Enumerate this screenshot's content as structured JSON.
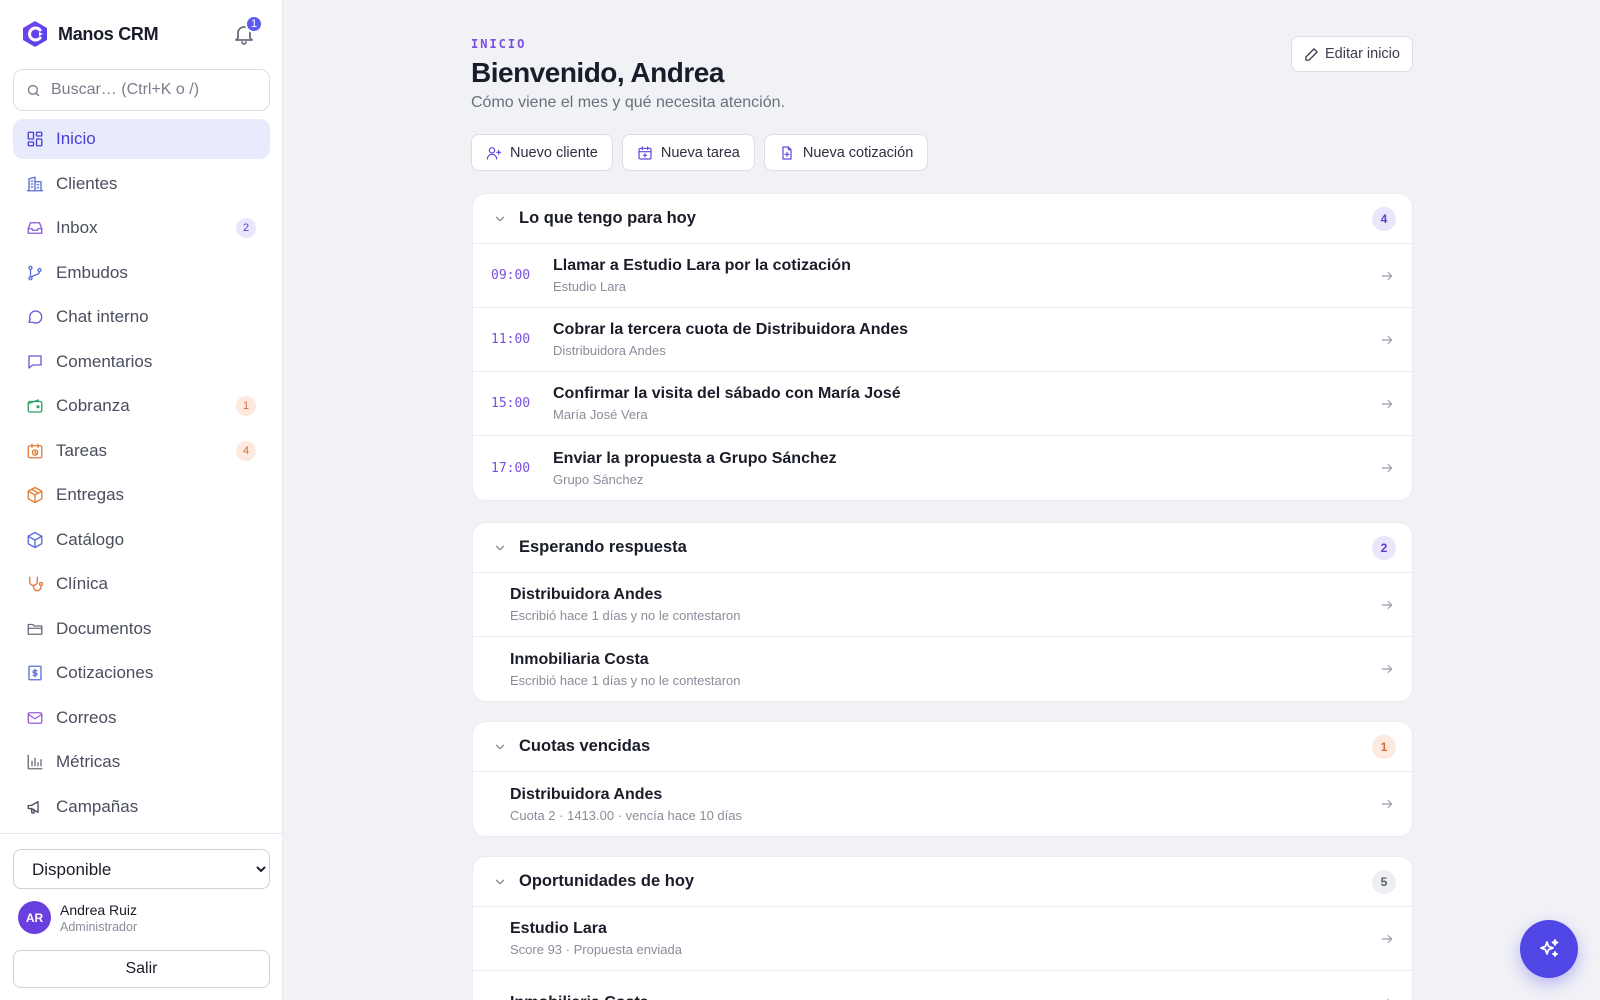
{
  "app": {
    "name": "Manos CRM",
    "notifications": "1"
  },
  "search": {
    "placeholder": "Buscar… (Ctrl+K o /)"
  },
  "nav": [
    {
      "label": "Inicio",
      "icon": "dashboard-icon",
      "active": true,
      "badge": ""
    },
    {
      "label": "Clientes",
      "icon": "building-icon",
      "badge": ""
    },
    {
      "label": "Inbox",
      "icon": "inbox-icon",
      "badge": "2",
      "badge_color": "purple"
    },
    {
      "label": "Embudos",
      "icon": "funnel-branch-icon",
      "badge": ""
    },
    {
      "label": "Chat interno",
      "icon": "chat-bubble-icon",
      "badge": ""
    },
    {
      "label": "Comentarios",
      "icon": "comment-icon",
      "badge": ""
    },
    {
      "label": "Cobranza",
      "icon": "wallet-icon",
      "badge": "1",
      "badge_color": "orange"
    },
    {
      "label": "Tareas",
      "icon": "alarm-calendar-icon",
      "badge": "4",
      "badge_color": "orange"
    },
    {
      "label": "Entregas",
      "icon": "package-icon",
      "badge": ""
    },
    {
      "label": "Catálogo",
      "icon": "box-icon",
      "badge": ""
    },
    {
      "label": "Clínica",
      "icon": "stethoscope-icon",
      "badge": ""
    },
    {
      "label": "Documentos",
      "icon": "folder-icon",
      "badge": ""
    },
    {
      "label": "Cotizaciones",
      "icon": "receipt-icon",
      "badge": ""
    },
    {
      "label": "Correos",
      "icon": "mail-icon",
      "badge": ""
    },
    {
      "label": "Métricas",
      "icon": "bar-chart-icon",
      "badge": ""
    },
    {
      "label": "Campañas",
      "icon": "megaphone-icon",
      "badge": ""
    }
  ],
  "footer": {
    "status": "Disponible",
    "user_initials": "AR",
    "user_name": "Andrea Ruiz",
    "user_role": "Administrador",
    "logout": "Salir"
  },
  "header": {
    "eyebrow": "INICIO",
    "title": "Bienvenido, Andrea",
    "subtitle": "Cómo viene el mes y qué necesita atención.",
    "edit": "Editar inicio"
  },
  "actions": [
    {
      "label": "Nuevo cliente",
      "icon": "user-plus-icon"
    },
    {
      "label": "Nueva tarea",
      "icon": "calendar-plus-icon"
    },
    {
      "label": "Nueva cotización",
      "icon": "file-plus-icon"
    }
  ],
  "sections": [
    {
      "title": "Lo que tengo para hoy",
      "count": "4",
      "count_color": "purple",
      "rows": [
        {
          "time": "09:00",
          "title": "Llamar a Estudio Lara por la cotización",
          "sub": "Estudio Lara"
        },
        {
          "time": "11:00",
          "title": "Cobrar la tercera cuota de Distribuidora Andes",
          "sub": "Distribuidora Andes"
        },
        {
          "time": "15:00",
          "title": "Confirmar la visita del sábado con María José",
          "sub": "María José Vera"
        },
        {
          "time": "17:00",
          "title": "Enviar la propuesta a Grupo Sánchez",
          "sub": "Grupo Sánchez"
        }
      ]
    },
    {
      "title": "Esperando respuesta",
      "count": "2",
      "count_color": "purple",
      "rows": [
        {
          "title": "Distribuidora Andes",
          "sub": "Escribió hace 1 días y no le contestaron"
        },
        {
          "title": "Inmobiliaria Costa",
          "sub": "Escribió hace 1 días y no le contestaron"
        }
      ]
    },
    {
      "title": "Cuotas vencidas",
      "count": "1",
      "count_color": "orange",
      "rows": [
        {
          "title": "Distribuidora Andes",
          "sub": "Cuota 2 · 1413.00 · vencía hace 10 días"
        }
      ]
    },
    {
      "title": "Oportunidades de hoy",
      "count": "5",
      "count_color": "grey",
      "rows": [
        {
          "title": "Estudio Lara",
          "sub": "Score 93 · Propuesta enviada"
        },
        {
          "title": "Inmobiliaria Costa",
          "sub": ""
        }
      ]
    }
  ],
  "fab": {
    "icon": "sparkles-icon"
  },
  "colors": {
    "accent": "#4f46e5",
    "eyebrow": "#7c4fe0",
    "active_bg": "#e8ebfc"
  }
}
